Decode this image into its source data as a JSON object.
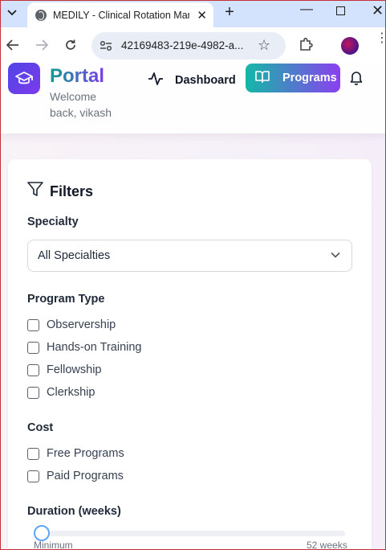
{
  "browser": {
    "tab_title": "MEDILY - Clinical Rotation Mark",
    "tab_close": "✕",
    "new_tab": "+",
    "url": "42169483-219e-4982-a..."
  },
  "header": {
    "app_name": "Portal",
    "welcome": "Welcome back, vikash",
    "dashboard_label": "Dashboard",
    "programs_label": "Programs"
  },
  "filters": {
    "title": "Filters",
    "specialty_label": "Specialty",
    "specialty_value": "All Specialties",
    "program_type_label": "Program Type",
    "program_types": [
      "Observership",
      "Hands-on Training",
      "Fellowship",
      "Clerkship"
    ],
    "cost_label": "Cost",
    "cost_options": [
      "Free Programs",
      "Paid Programs"
    ],
    "duration_label": "Duration (weeks)",
    "duration_min_label": "Minimum",
    "duration_max_label": "52 weeks",
    "duration_value_fraction": 0
  },
  "colors": {
    "accent_teal": "#14b8a6",
    "accent_purple": "#7c3aed",
    "slider_thumb_border": "#60a5fa"
  },
  "icons": {
    "tab_menu": "chevron-down-icon",
    "favicon": "globe-icon",
    "back": "arrow-left-icon",
    "forward": "arrow-right-icon",
    "reload": "reload-icon",
    "site_info": "tune-icon",
    "bookmark": "star-icon",
    "extensions": "puzzle-icon",
    "menu": "kebab-icon",
    "logo": "graduation-cap-icon",
    "dashboard": "activity-icon",
    "programs": "book-open-icon",
    "notifications": "bell-icon",
    "filters": "funnel-icon",
    "select": "chevron-down-icon"
  }
}
